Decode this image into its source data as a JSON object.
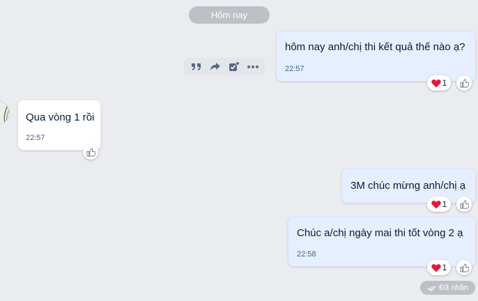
{
  "date_divider": "Hôm nay",
  "toolbar": {
    "icons": [
      "quote-icon",
      "forward-icon",
      "select-icon",
      "more-icon"
    ]
  },
  "messages": [
    {
      "direction": "outgoing",
      "text": "hôm nay anh/chị thi kết quả thế nào ạ?",
      "time": "22:57",
      "heart_count": "1"
    },
    {
      "direction": "incoming",
      "text": "Qua vòng 1 rồi",
      "time": "22:57"
    },
    {
      "direction": "outgoing",
      "text": "3M chúc mừng anh/chị ạ",
      "heart_count": "1"
    },
    {
      "direction": "outgoing",
      "text": "Chúc a/chị ngày mai thi tốt vòng 2 ạ",
      "time": "22:58",
      "heart_count": "1"
    }
  ],
  "status": "Đã nhận",
  "colors": {
    "background": "#ebecf0",
    "outgoing_bubble": "#e5efff",
    "incoming_bubble": "#ffffff",
    "heart": "#e01b3c",
    "time_text": "#476285"
  }
}
